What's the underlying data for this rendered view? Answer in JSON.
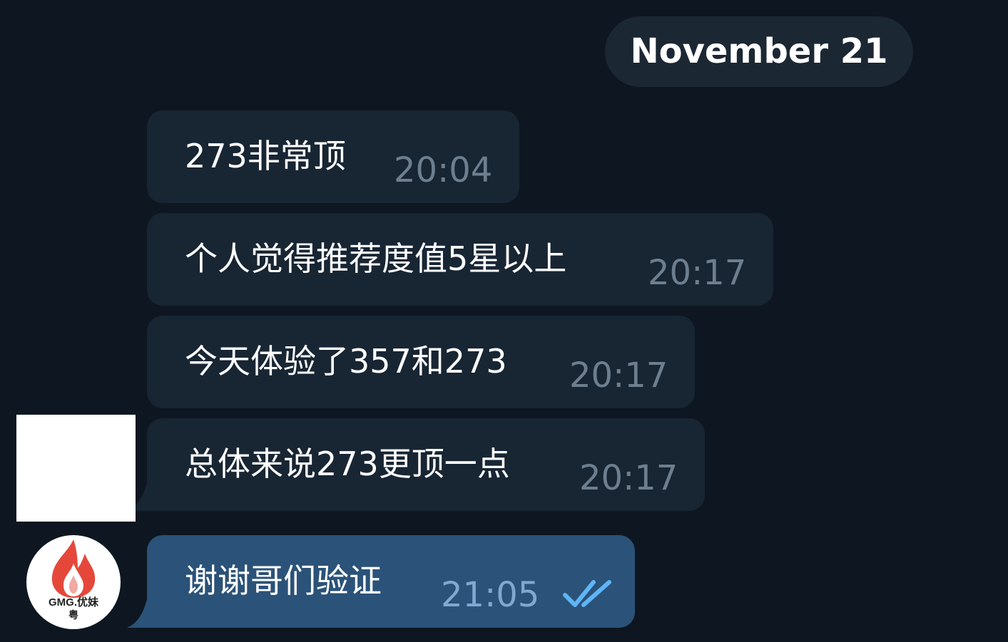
{
  "chat": {
    "date_separator": "November 21",
    "messages": [
      {
        "text": "273非常顶",
        "time": "20:04",
        "direction": "incoming"
      },
      {
        "text": "个人觉得推荐度值5星以上",
        "time": "20:17",
        "direction": "incoming"
      },
      {
        "text": "今天体验了357和273",
        "time": "20:17",
        "direction": "incoming"
      },
      {
        "text": "总体来说273更顶一点",
        "time": "20:17",
        "direction": "incoming"
      },
      {
        "text": "谢谢哥们验证",
        "time": "21:05",
        "direction": "outgoing",
        "status": "read",
        "status_icon": "double-check-icon"
      }
    ]
  },
  "avatars": {
    "incoming_sender": {
      "type": "blank-avatar"
    },
    "outgoing_sender": {
      "type": "logo-avatar",
      "logo_text": "GMG.优妹",
      "logo_subtext": "粤",
      "icon": "flame-icon"
    }
  },
  "colors": {
    "background": "#0e1621",
    "incoming_bubble": "#182533",
    "outgoing_bubble": "#2b5278",
    "date_pill": "#1c2734",
    "time_incoming": "#6d7f8f",
    "time_outgoing": "#7fa9d1",
    "read_check": "#5eb5f7",
    "flame": "#e5483b"
  }
}
